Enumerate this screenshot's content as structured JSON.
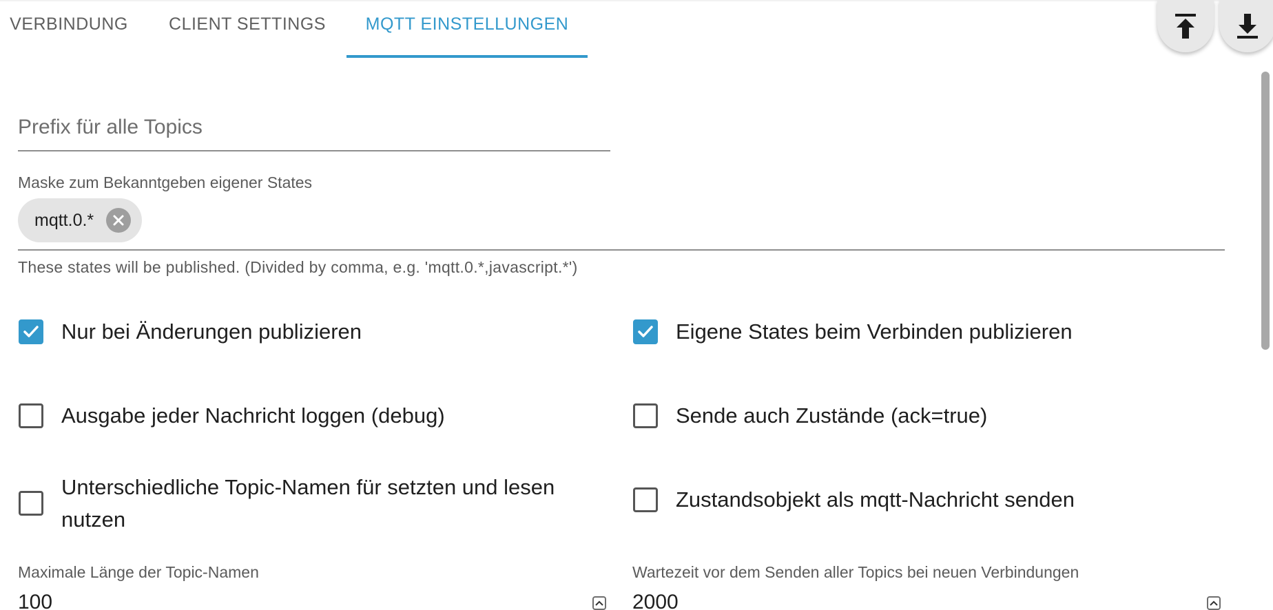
{
  "tabs": [
    {
      "label": "VERBINDUNG"
    },
    {
      "label": "CLIENT SETTINGS"
    },
    {
      "label": "MQTT EINSTELLUNGEN"
    }
  ],
  "active_tab": "MQTT EINSTELLUNGEN",
  "toolbar": {
    "upload_icon": "upload-icon",
    "download_icon": "download-icon"
  },
  "prefix": {
    "placeholder": "Prefix für alle Topics",
    "value": ""
  },
  "mask": {
    "label": "Maske zum Bekanntgeben eigener States",
    "chips": [
      {
        "label": "mqtt.0.*"
      }
    ],
    "helper": "These states will be published. (Divided by comma, e.g. 'mqtt.0.*,javascript.*')"
  },
  "options": {
    "left": [
      {
        "label": "Nur bei Änderungen publizieren",
        "checked": true
      },
      {
        "label": "Ausgabe jeder Nachricht loggen (debug)",
        "checked": false
      },
      {
        "label": "Unterschiedliche Topic-Namen für setzten und lesen nutzen",
        "checked": false
      }
    ],
    "right": [
      {
        "label": "Eigene States beim Verbinden publizieren",
        "checked": true
      },
      {
        "label": "Sende auch Zustände (ack=true)",
        "checked": false
      },
      {
        "label": "Zustandsobjekt als mqtt-Nachricht senden",
        "checked": false
      }
    ]
  },
  "max_topic_length": {
    "label": "Maximale Länge der Topic-Namen",
    "value": "100"
  },
  "send_interval": {
    "label": "Wartezeit vor dem Senden aller Topics bei neuen Verbindungen",
    "value": "2000"
  },
  "colors": {
    "accent": "#3399cc",
    "text": "#1f1f1f",
    "secondary_text": "#5b5b5b"
  }
}
